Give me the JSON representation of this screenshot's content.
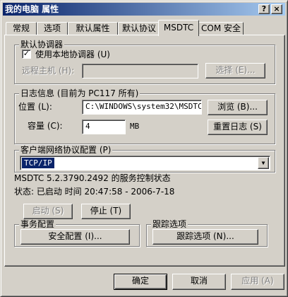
{
  "window": {
    "title": "我的电脑 属性",
    "help_btn": "?",
    "close_btn": "×"
  },
  "tabs": [
    {
      "label": "常规"
    },
    {
      "label": "选项"
    },
    {
      "label": "默认属性"
    },
    {
      "label": "默认协议"
    },
    {
      "label": "MSDTC",
      "active": true
    },
    {
      "label": "COM 安全"
    }
  ],
  "coordinator": {
    "title": "默认协调器",
    "use_local_label": "使用本地协调器 (U)",
    "use_local_checked": true,
    "check_mark": "✓",
    "remote_host_label": "远程主机 (H):",
    "remote_host_value": "",
    "select_button": "选择 (E)..."
  },
  "log": {
    "title": "日志信息 (目前为 PC117 所有)",
    "location_label": "位置 (L):",
    "location_value": "C:\\WINDOWS\\system32\\MSDTC",
    "browse_button": "浏览 (B)...",
    "capacity_label": "容量 (C):",
    "capacity_value": "4",
    "capacity_unit": "MB",
    "reset_button": "重置日志 (S)"
  },
  "network": {
    "title": "客户端网络协议配置 (P)",
    "selected": "TCP/IP",
    "arrow": "▼"
  },
  "status": {
    "title": "MSDTC 5.2.3790.2492 的服务控制状态",
    "status_text": "状态: 已启动 时间 20:47:58 - 2006-7-18",
    "start_button": "启动 (S)",
    "stop_button": "停止 (T)"
  },
  "transaction": {
    "title": "事务配置",
    "security_button": "安全配置 (I)..."
  },
  "tracing": {
    "title": "跟踪选项",
    "tracing_button": "跟踪选项 (N)..."
  },
  "footer": {
    "ok": "确定",
    "cancel": "取消",
    "apply": "应用 (A)"
  }
}
